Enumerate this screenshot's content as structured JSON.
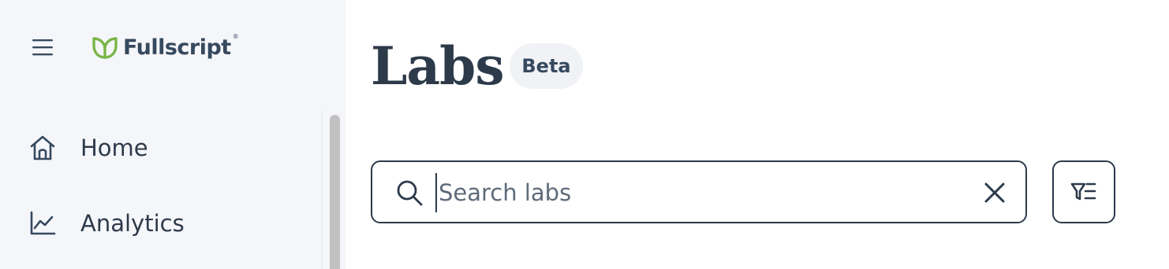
{
  "sidebar": {
    "menu_icon": "hamburger-icon",
    "logo": {
      "text": "Fullscript",
      "mark": "®",
      "icon": "leaf-logo-icon",
      "brand_color": "#7ab648"
    },
    "items": [
      {
        "label": "Home",
        "icon": "home-icon"
      },
      {
        "label": "Analytics",
        "icon": "analytics-chart-icon"
      }
    ]
  },
  "main": {
    "title": "Labs",
    "badge": "Beta",
    "search": {
      "placeholder": "Search labs",
      "value": ""
    },
    "icons": {
      "search": "search-icon",
      "clear": "close-icon",
      "filter": "filter-list-icon"
    }
  },
  "colors": {
    "text": "#2d3a4a",
    "sidebar_bg": "#f5f6fa",
    "badge_bg": "#f0f2f6",
    "accent_green": "#7ab648"
  }
}
